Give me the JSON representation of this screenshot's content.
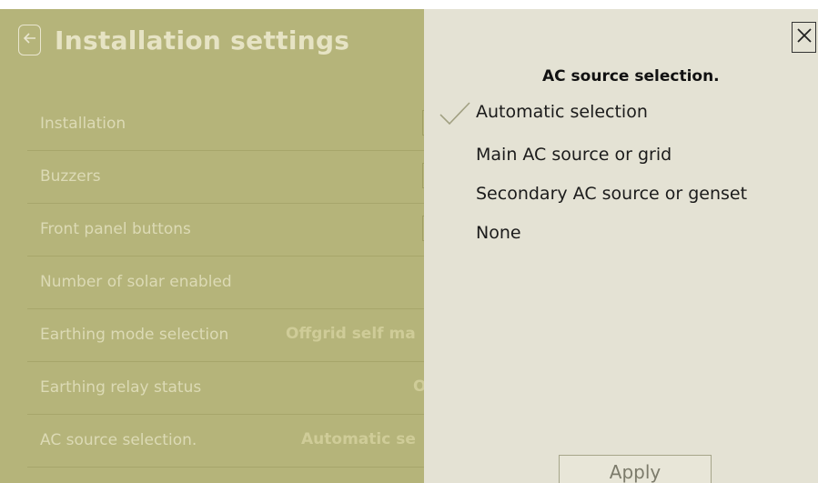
{
  "header": {
    "title": "Installation settings",
    "back_icon": "arrow-left-icon"
  },
  "settings": [
    {
      "label": "Installation",
      "value": ""
    },
    {
      "label": "Buzzers",
      "value": ""
    },
    {
      "label": "Front panel buttons",
      "value": ""
    },
    {
      "label": "Number of solar enabled",
      "value": ""
    },
    {
      "label": "Earthing mode selection",
      "value": "Offgrid self ma"
    },
    {
      "label": "Earthing relay status",
      "value": "O"
    },
    {
      "label": "AC source selection.",
      "value": "Automatic se"
    }
  ],
  "drawer": {
    "title": "AC source selection.",
    "close_icon": "close-icon",
    "options": [
      {
        "label": "Automatic selection",
        "selected": true
      },
      {
        "label": "Main AC source or grid",
        "selected": false
      },
      {
        "label": "Secondary AC source or genset",
        "selected": false
      },
      {
        "label": "None",
        "selected": false
      }
    ],
    "apply_label": "Apply"
  },
  "colors": {
    "overlay": "#b4b378",
    "drawer_bg": "#e4e2d4",
    "text_dim": "#dcdab5",
    "title": "#e6e3c4"
  }
}
